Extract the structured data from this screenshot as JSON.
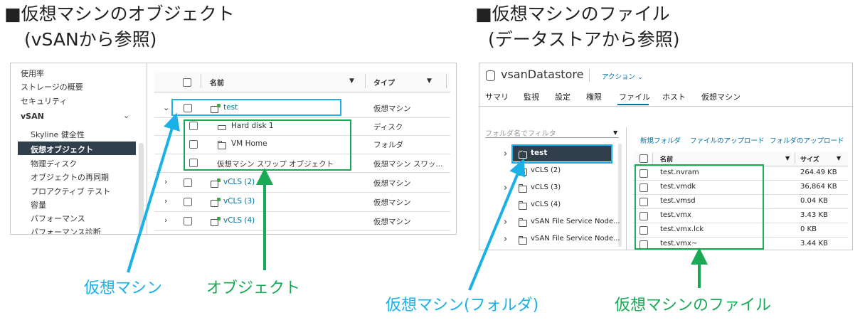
{
  "left": {
    "heading_line1": "■仮想マシンのオブジェクト",
    "heading_line2": "(vSANから参照)",
    "sidebar": {
      "items": [
        "使用率",
        "ストレージの概要",
        "セキュリティ"
      ],
      "group": "vSAN",
      "group_items": [
        "Skyline 健全性",
        "仮想オブジェクト",
        "物理ディスク",
        "オブジェクトの再同期",
        "プロアクティブ テスト",
        "容量",
        "パフォーマンス",
        "パフォーマンス診断"
      ]
    },
    "table": {
      "col_name": "名前",
      "col_type": "タイプ",
      "rows": [
        {
          "name": "test",
          "type": "仮想マシン"
        },
        {
          "name": "Hard disk 1",
          "type": "ディスク"
        },
        {
          "name": "VM Home",
          "type": "フォルダ"
        },
        {
          "name": "仮想マシン スワップ オブジェクト",
          "type": "仮想マシン スワッ..."
        },
        {
          "name": "vCLS (2)",
          "type": "仮想マシン"
        },
        {
          "name": "vCLS (3)",
          "type": "仮想マシン"
        },
        {
          "name": "vCLS (4)",
          "type": "仮想マシン"
        }
      ]
    },
    "callout_vm": "仮想マシン",
    "callout_object": "オブジェクト"
  },
  "right": {
    "heading_line1": "■仮想マシンのファイル",
    "heading_line2": "(データストアから参照)",
    "datastore_title": "vsanDatastore",
    "actions_label": "アクション",
    "tabs": [
      "サマリ",
      "監視",
      "設定",
      "権限",
      "ファイル",
      "ホスト",
      "仮想マシン"
    ],
    "filter_placeholder": "フォルダ名でフィルタ",
    "toolbar": [
      "新規フォルダ",
      "ファイルのアップロード",
      "フォルダのアップロード"
    ],
    "folders": [
      "test",
      "vCLS (2)",
      "vCLS (3)",
      "vCLS (4)",
      "vSAN File Service Node...",
      "vSAN File Service Node..."
    ],
    "files_header": {
      "name": "名前",
      "size": "サイズ"
    },
    "files": [
      {
        "name": "test.nvram",
        "size": "264.49 KB"
      },
      {
        "name": "test.vmdk",
        "size": "36,864 KB"
      },
      {
        "name": "test.vmsd",
        "size": "0.04 KB"
      },
      {
        "name": "test.vmx",
        "size": "3.43 KB"
      },
      {
        "name": "test.vmx.lck",
        "size": "0 KB"
      },
      {
        "name": "test.vmx~",
        "size": "3.44 KB"
      }
    ],
    "callout_folder": "仮想マシン(フォルダ)",
    "callout_files": "仮想マシンのファイル"
  },
  "colors": {
    "blue": "#1ab0e8",
    "green": "#1aaa55",
    "sidebar_selected": "#313e4b"
  }
}
